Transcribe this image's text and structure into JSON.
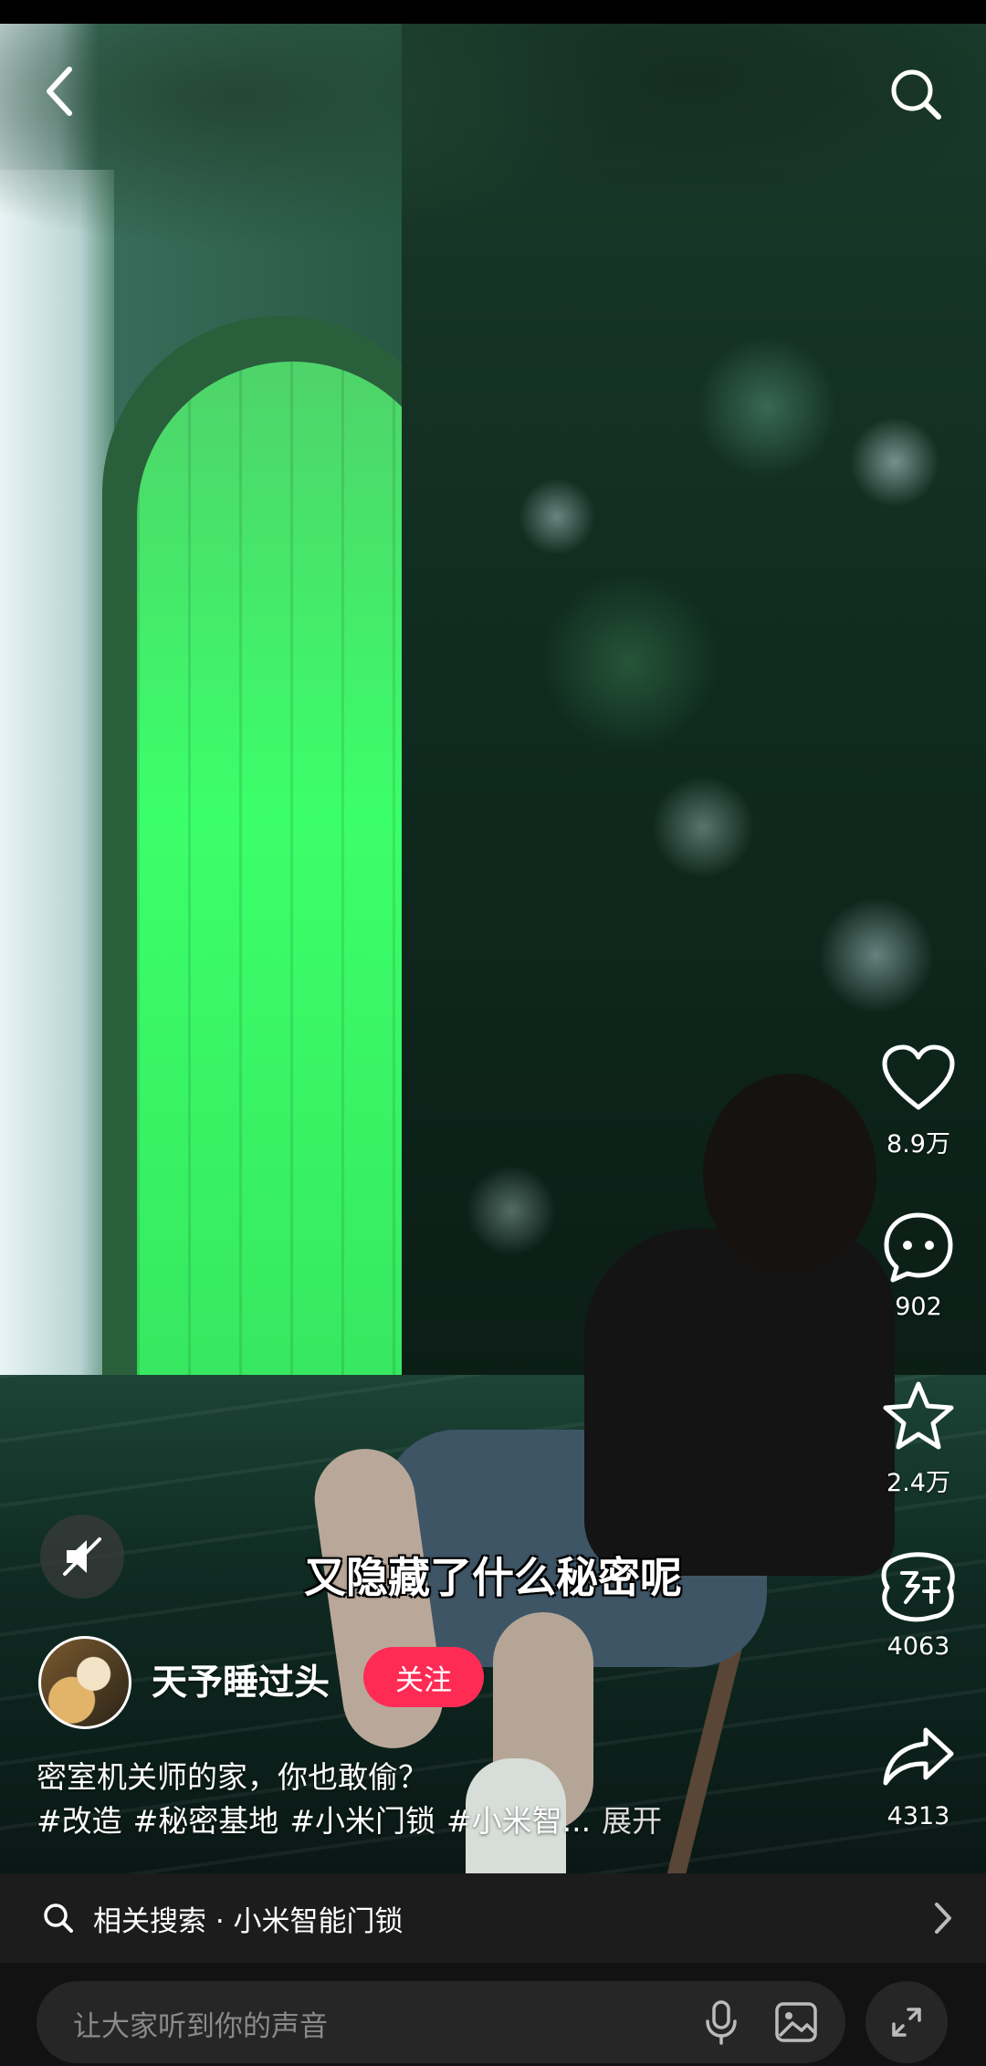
{
  "video": {
    "subtitle": "又隐藏了什么秘密呢"
  },
  "actions": {
    "like_count": "8.9万",
    "comment_count": "902",
    "favorite_count": "2.4万",
    "recommend_count": "4063",
    "share_count": "4313"
  },
  "author": {
    "name": "天予睡过头",
    "follow_label": "关注"
  },
  "post": {
    "caption": "密室机关师的家，你也敢偷？",
    "hashtags": [
      "#改造",
      "#秘密基地",
      "#小米门锁",
      "#小米智..."
    ],
    "expand_label": "展开"
  },
  "related_search": {
    "label": "相关搜索 · 小米智能门锁"
  },
  "comment_bar": {
    "placeholder": "让大家听到你的声音"
  },
  "icons": {
    "back": "chevron-left-icon",
    "search": "search-icon",
    "like": "heart-icon",
    "comment": "comment-bubble-icon",
    "favorite": "star-icon",
    "recommend": "recommend-icon",
    "share": "share-arrow-icon",
    "mute": "speaker-muted-icon",
    "mic": "mic-icon",
    "image": "image-icon",
    "expand": "fullscreen-icon"
  },
  "colors": {
    "follow_button": "#fe2c55",
    "bar_background": "#262626"
  }
}
